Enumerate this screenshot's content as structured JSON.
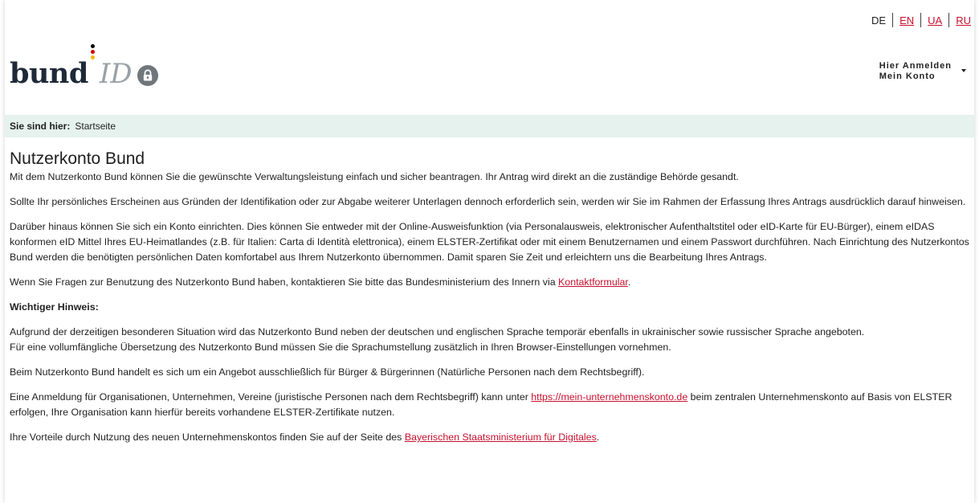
{
  "languages": {
    "current": "DE",
    "links": [
      "EN",
      "UA",
      "RU"
    ]
  },
  "logo": {
    "word": "bund",
    "suffix": "ID",
    "dot_colors": [
      "#000000",
      "#d00000",
      "#f5b700"
    ]
  },
  "account_menu": {
    "line1": "Hier Anmelden",
    "line2": "Mein Konto"
  },
  "breadcrumb": {
    "label": "Sie sind hier:",
    "current": "Startseite"
  },
  "main": {
    "title": "Nutzerkonto Bund",
    "p1": "Mit dem Nutzerkonto Bund können Sie die gewünschte Verwaltungsleistung einfach und sicher beantragen. Ihr Antrag wird direkt an die zuständige Behörde gesandt.",
    "p2": "Sollte Ihr persönliches Erscheinen aus Gründen der Identifikation oder zur Abgabe weiterer Unterlagen dennoch erforderlich sein, werden wir Sie im Rahmen der Erfassung Ihres Antrags ausdrücklich darauf hinweisen.",
    "p3": "Darüber hinaus können Sie sich ein Konto einrichten. Dies können Sie entweder mit der Online-Ausweisfunktion (via Personalausweis, elektronischer Aufenthaltstitel oder eID-Karte für EU-Bürger), einem eIDAS konformen eID Mittel Ihres EU-Heimatlandes (z.B. für Italien: Carta di Identità elettronica), einem ELSTER-Zertifikat oder mit einem Benutzernamen und einem Passwort durchführen. Nach Einrichtung des Nutzerkontos Bund werden die benötigten persönlichen Daten komfortabel aus Ihrem Nutzerkonto übernommen. Damit sparen Sie Zeit und erleichtern uns die Bearbeitung Ihres Antrags.",
    "p4_before": "Wenn Sie Fragen zur Benutzung des Nutzerkonto Bund haben, kontaktieren Sie bitte das Bundesministerium des Innern via ",
    "p4_link": "Kontaktformular",
    "p4_after": ".",
    "notice_heading": "Wichtiger Hinweis:",
    "p5_line1": "Aufgrund der derzeitigen besonderen Situation wird das Nutzerkonto Bund neben der deutschen und englischen Sprache temporär ebenfalls in ukrainischer sowie russischer Sprache angeboten.",
    "p5_line2": "Für eine vollumfängliche Übersetzung des Nutzerkonto Bund müssen Sie die Sprachumstellung zusätzlich in Ihren Browser-Einstellungen vornehmen.",
    "p6": "Beim Nutzerkonto Bund handelt es sich um ein Angebot ausschließlich für Bürger & Bürgerinnen (Natürliche Personen nach dem Rechtsbegriff).",
    "p7_before": "Eine Anmeldung für Organisationen, Unternehmen, Vereine (juristische Personen nach dem Rechtsbegriff) kann unter ",
    "p7_link": "https://mein-unternehmenskonto.de",
    "p7_after": " beim zentralen Unternehmenskonto auf Basis von ELSTER erfolgen, Ihre Organisation kann hierfür bereits vorhandene ELSTER-Zertifikate nutzen.",
    "p8_before": "Ihre Vorteile durch Nutzung des neuen Unternehmenskontos finden Sie auf der Seite des ",
    "p8_link": "Bayerischen Staatsministerium für Digitales",
    "p8_after": "."
  },
  "colors": {
    "link": "#c8102e",
    "breadcrumb_bg": "#e5f2ee",
    "logo_text": "#1e2a38",
    "logo_id": "#9aa0a6"
  },
  "icons": [
    "lock-icon",
    "chevron-down-icon"
  ]
}
